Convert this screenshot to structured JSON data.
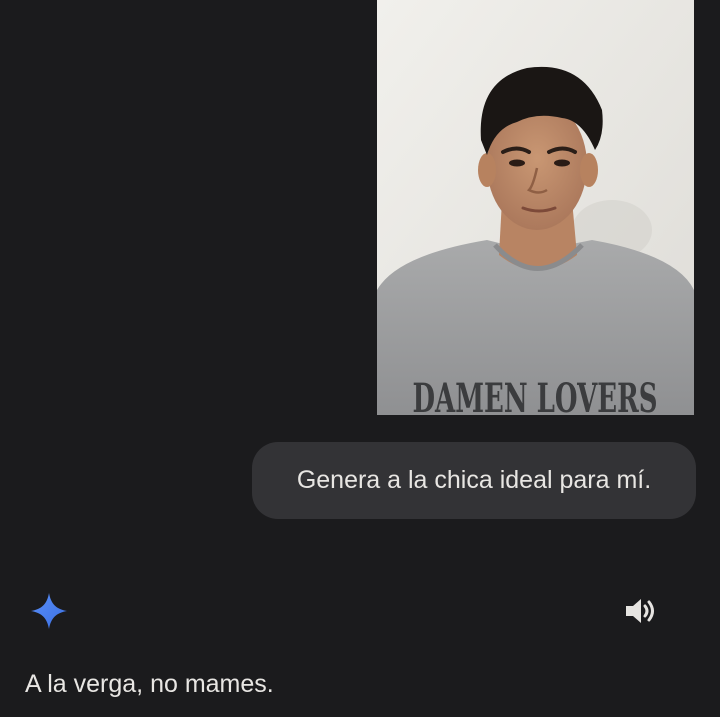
{
  "conversation": {
    "user_photo": {
      "shirt_text": "DAMEN LOVERS"
    },
    "user_message": "Genera a la chica ideal para mí.",
    "assistant": {
      "icon": "gemini-sparkle-icon",
      "read_aloud_icon": "speaker-icon",
      "reply": "A la verga, no mames."
    }
  },
  "colors": {
    "background": "#1b1b1d",
    "bubble": "#333336",
    "text": "#e8e6e3",
    "sparkle": "#4a86f7"
  }
}
